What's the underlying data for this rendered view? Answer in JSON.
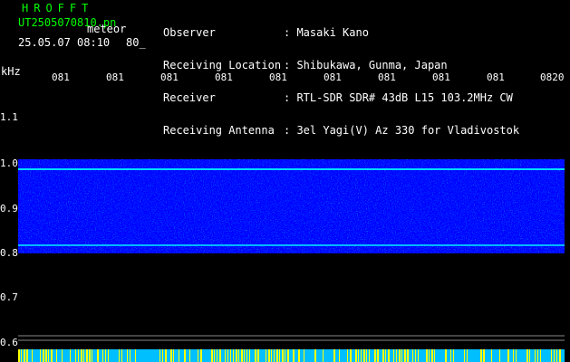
{
  "header": {
    "brand": "HROFFT",
    "filename": "UT2505070810.pn",
    "meteor_label": "meteor",
    "timestamp": "25.05.07 08:10",
    "count": "80_"
  },
  "info": {
    "observer_label": "Observer",
    "observer_value": ": Masaki Kano",
    "location_label": "Receiving Location",
    "location_value": ": Shibukawa, Gunma, Japan",
    "receiver_label": "Receiver",
    "receiver_value": ": RTL-SDR SDR# 43dB L15 103.2MHz CW",
    "antenna_label": "Receiving Antenna",
    "antenna_value": ": 3el Yagi(V) Az 330 for Vladivostok"
  },
  "axis": {
    "y_unit": "kHz",
    "y_ticks": [
      "1.1",
      "1.0",
      "0.9",
      "0.8",
      "0.7",
      "0.6"
    ],
    "x_ticks": [
      "081",
      "081",
      "081",
      "081",
      "081",
      "081",
      "081",
      "081",
      "081",
      "0820"
    ]
  },
  "colors": {
    "accent_green": "#00ff00",
    "band_blue": "#0000ff",
    "line_cyan": "#00ffff",
    "bottom_bar": "#00bfff",
    "bottom_ticks": "#ffff00"
  }
}
